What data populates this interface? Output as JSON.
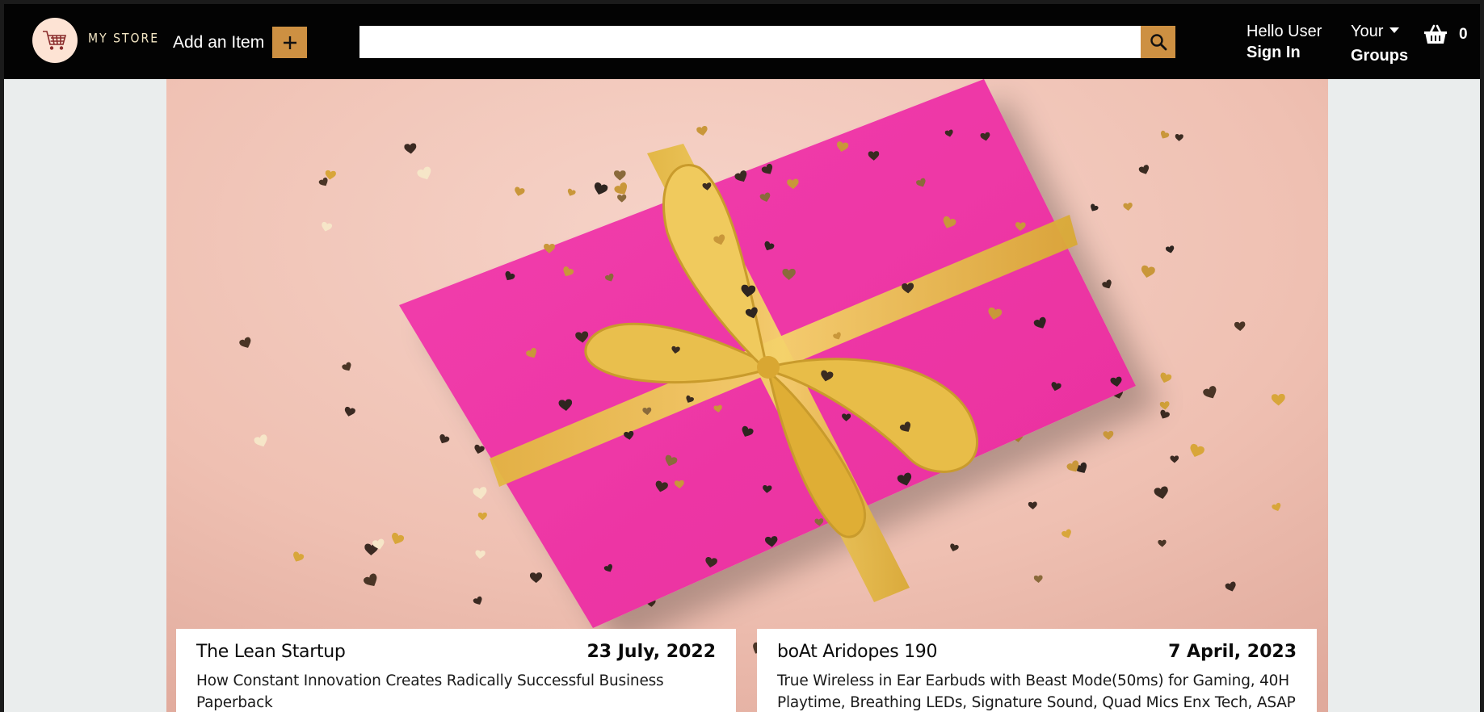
{
  "header": {
    "brand": "MY STORE",
    "add_item_label": "Add an Item",
    "search": {
      "value": "",
      "placeholder": ""
    },
    "account": {
      "line_one": "Hello User",
      "line_two": "Sign In"
    },
    "groups": {
      "line_one": "Your",
      "line_two": "Groups"
    },
    "basket_count": "0",
    "accent_color": "#cd9042"
  },
  "hero": {
    "description": "pink-gift-box-gold-ribbon-hearts"
  },
  "products": [
    {
      "title": "The Lean Startup",
      "date": "23 July, 2022",
      "description": "How Constant Innovation Creates Radically Successful Business Paperback"
    },
    {
      "title": "boAt Aridopes 190",
      "date": "7 April, 2023",
      "description": "True Wireless in Ear Earbuds with Beast Mode(50ms) for Gaming, 40H Playtime, Breathing LEDs, Signature Sound, Quad Mics Enx Tech, ASAP"
    }
  ]
}
